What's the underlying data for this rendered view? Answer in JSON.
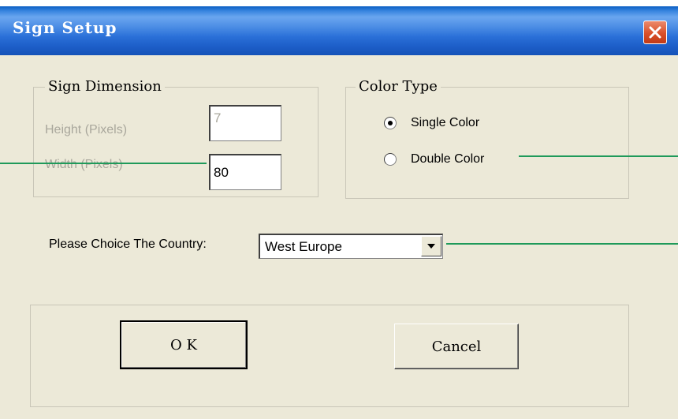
{
  "window": {
    "title": "Sign Setup"
  },
  "sign_dimension": {
    "label": "Sign Dimension",
    "height_label": "Height (Pixels)",
    "height_value": "7",
    "width_label": "Width (Pixels)",
    "width_value": "80"
  },
  "color_type": {
    "label": "Color Type",
    "options": [
      {
        "label": "Single Color",
        "selected": true
      },
      {
        "label": "Double Color",
        "selected": false
      }
    ]
  },
  "country": {
    "label": "Please Choice The Country:",
    "selected": "West Europe"
  },
  "buttons": {
    "ok_label": "O K",
    "cancel_label": "Cancel"
  },
  "colors": {
    "titlebar": "#1d5ec8",
    "dialog_bg": "#ece9d8",
    "annotation_line": "#1f9a5a",
    "close_button": "#d9502a"
  },
  "icons": {
    "close": "close-icon",
    "dropdown": "chevron-down-icon"
  }
}
